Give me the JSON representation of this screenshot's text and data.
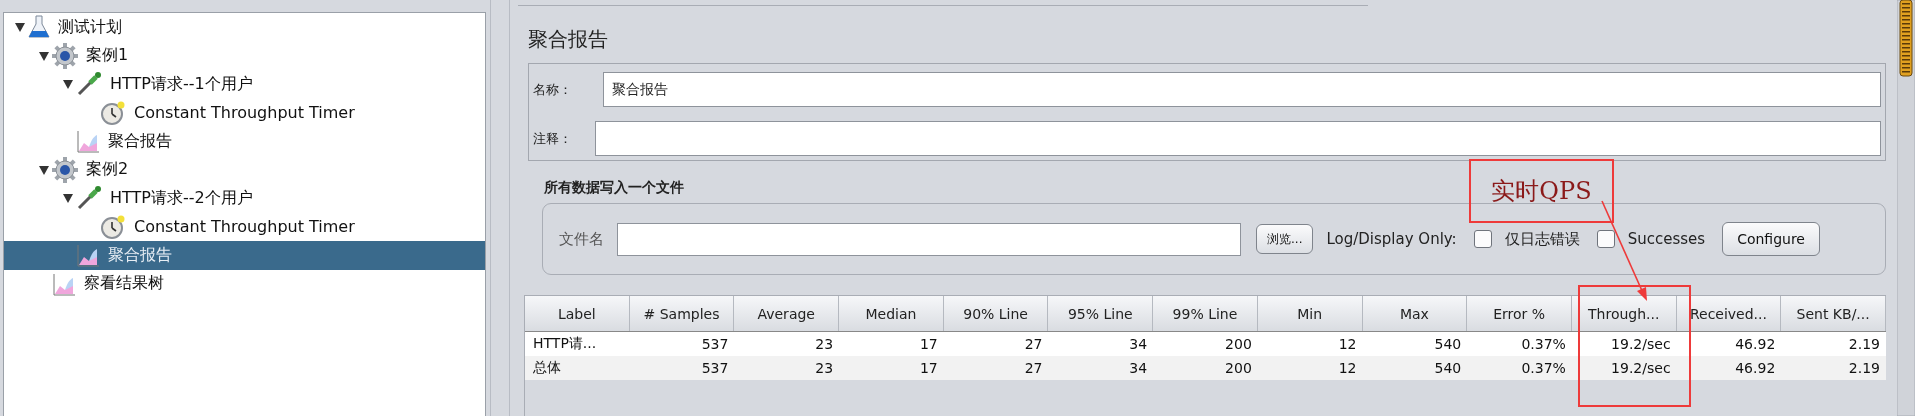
{
  "tree": [
    {
      "label": "测试计划",
      "kind": "plan",
      "expanded": true,
      "selected": false,
      "children": [
        {
          "label": "案例1",
          "kind": "group",
          "expanded": true,
          "selected": false,
          "children": [
            {
              "label": "HTTP请求--1个用户",
              "kind": "sampler",
              "expanded": true,
              "selected": false,
              "children": [
                {
                  "label": "Constant Throughput Timer",
                  "kind": "timer",
                  "selected": false
                }
              ]
            },
            {
              "label": "聚合报告",
              "kind": "listener",
              "selected": false
            }
          ]
        },
        {
          "label": "案例2",
          "kind": "group",
          "expanded": true,
          "selected": false,
          "children": [
            {
              "label": "HTTP请求--2个用户",
              "kind": "sampler",
              "expanded": true,
              "selected": false,
              "children": [
                {
                  "label": "Constant Throughput Timer",
                  "kind": "timer",
                  "selected": false
                }
              ]
            },
            {
              "label": "聚合报告",
              "kind": "listener",
              "selected": true
            }
          ]
        },
        {
          "label": "察看结果树",
          "kind": "listener",
          "selected": false
        }
      ]
    }
  ],
  "panel": {
    "title": "聚合报告",
    "name_field": {
      "label": "名称：",
      "value": "聚合报告"
    },
    "comment_field": {
      "label": "注释："
    },
    "file_section": {
      "title": "所有数据写入一个文件",
      "file_label": "文件名",
      "browse_button": "浏览...",
      "log_display_label": "Log/Display Only:",
      "checkboxes": [
        {
          "label": "仅日志错误",
          "checked": false
        },
        {
          "label": "Successes",
          "checked": false
        }
      ],
      "configure_button": "Configure"
    },
    "table": {
      "columns": [
        "Label",
        "# Samples",
        "Average",
        "Median",
        "90% Line",
        "95% Line",
        "99% Line",
        "Min",
        "Max",
        "Error %",
        "Through...",
        "Received...",
        "Sent KB/..."
      ],
      "rows": [
        [
          "HTTP请...",
          "537",
          "23",
          "17",
          "27",
          "34",
          "200",
          "12",
          "540",
          "0.37%",
          "19.2/sec",
          "46.92",
          "2.19"
        ],
        [
          "总体",
          "537",
          "23",
          "17",
          "27",
          "34",
          "200",
          "12",
          "540",
          "0.37%",
          "19.2/sec",
          "46.92",
          "2.19"
        ]
      ]
    }
  },
  "annotation": {
    "label": "实时QPS"
  }
}
